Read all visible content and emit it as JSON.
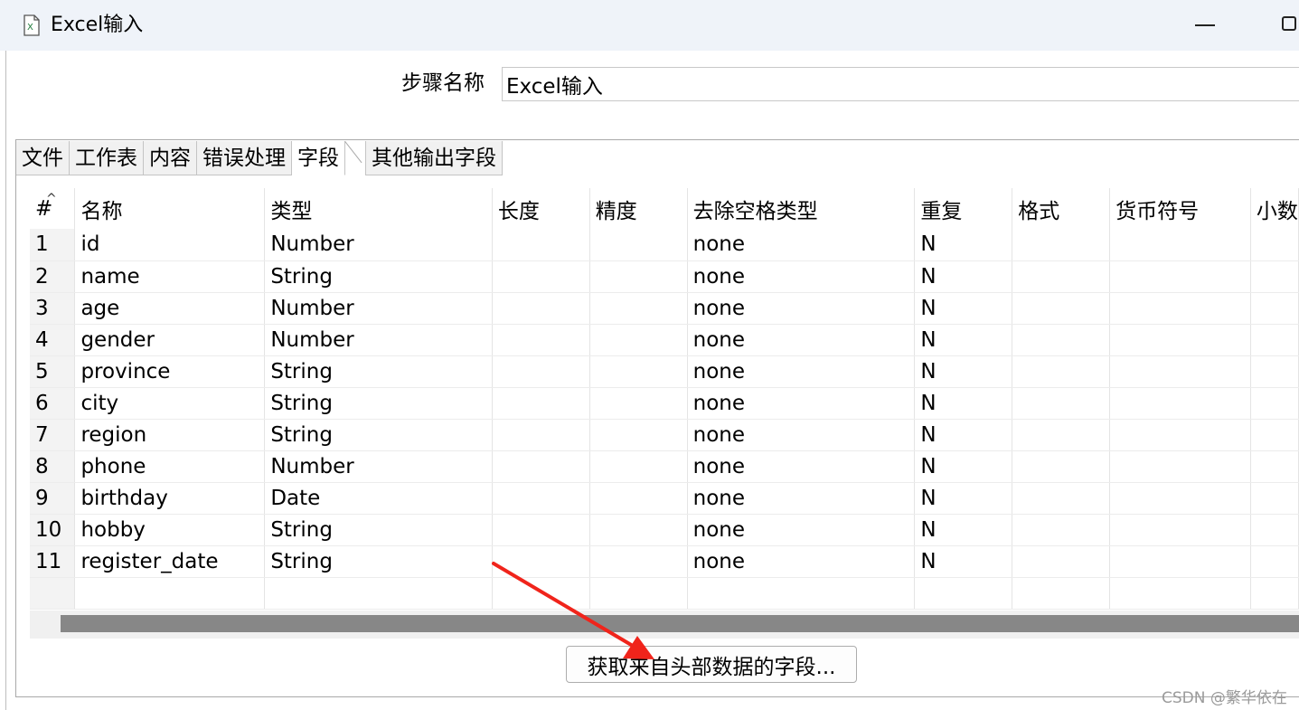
{
  "window": {
    "title": "Excel输入"
  },
  "step": {
    "label": "步骤名称",
    "value": "Excel输入"
  },
  "tabs": [
    {
      "label": "文件"
    },
    {
      "label": "工作表"
    },
    {
      "label": "内容"
    },
    {
      "label": "错误处理"
    },
    {
      "label": "字段",
      "active": true
    },
    {
      "label": "其他输出字段"
    }
  ],
  "table": {
    "columns": [
      "#",
      "名称",
      "类型",
      "长度",
      "精度",
      "去除空格类型",
      "重复",
      "格式",
      "货币符号",
      "小数"
    ],
    "rows": [
      {
        "num": "1",
        "name": "id",
        "type": "Number",
        "trim": "none",
        "repeat": "N"
      },
      {
        "num": "2",
        "name": "name",
        "type": "String",
        "trim": "none",
        "repeat": "N"
      },
      {
        "num": "3",
        "name": "age",
        "type": "Number",
        "trim": "none",
        "repeat": "N"
      },
      {
        "num": "4",
        "name": "gender",
        "type": "Number",
        "trim": "none",
        "repeat": "N"
      },
      {
        "num": "5",
        "name": "province",
        "type": "String",
        "trim": "none",
        "repeat": "N"
      },
      {
        "num": "6",
        "name": "city",
        "type": "String",
        "trim": "none",
        "repeat": "N"
      },
      {
        "num": "7",
        "name": "region",
        "type": "String",
        "trim": "none",
        "repeat": "N"
      },
      {
        "num": "8",
        "name": "phone",
        "type": "Number",
        "trim": "none",
        "repeat": "N"
      },
      {
        "num": "9",
        "name": "birthday",
        "type": "Date",
        "trim": "none",
        "repeat": "N"
      },
      {
        "num": "10",
        "name": "hobby",
        "type": "String",
        "trim": "none",
        "repeat": "N"
      },
      {
        "num": "11",
        "name": "register_date",
        "type": "String",
        "trim": "none",
        "repeat": "N"
      }
    ]
  },
  "buttons": {
    "get_fields": "获取来自头部数据的字段..."
  },
  "annotation": {
    "arrow_color": "#f0241b"
  },
  "watermark": "CSDN @繁华依在"
}
